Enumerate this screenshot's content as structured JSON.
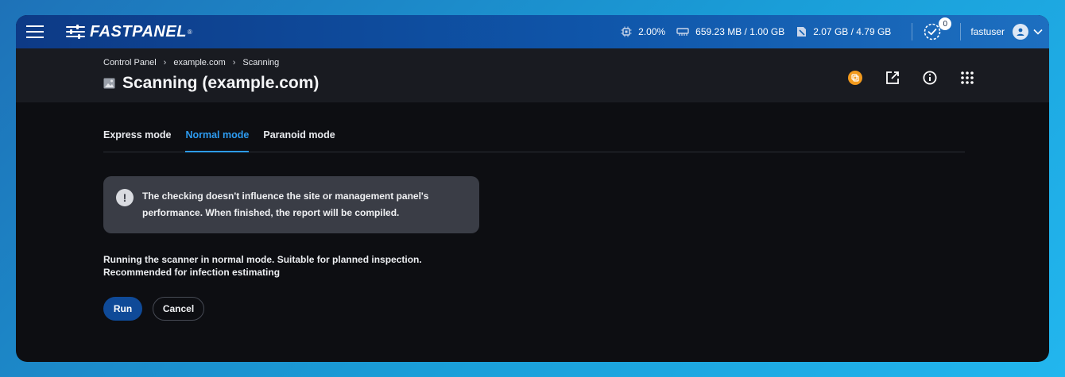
{
  "topbar": {
    "logo_text": "FASTPANEL",
    "logo_reg": "®",
    "cpu": "2.00%",
    "ram": "659.23 MB / 1.00 GB",
    "disk": "2.07 GB / 4.79 GB",
    "tasks_count": "0",
    "username": "fastuser"
  },
  "breadcrumb": {
    "items": [
      "Control Panel",
      "example.com",
      "Scanning"
    ],
    "separator": "›"
  },
  "page": {
    "title": "Scanning (example.com)"
  },
  "tabs": [
    {
      "label": "Express mode",
      "active": false
    },
    {
      "label": "Normal mode",
      "active": true
    },
    {
      "label": "Paranoid mode",
      "active": false
    }
  ],
  "notice": {
    "icon": "!",
    "line1": "The checking doesn't influence the site or management panel's",
    "line2": "performance. When finished, the report will be compiled."
  },
  "description": {
    "line1": "Running the scanner in normal mode. Suitable for planned inspection.",
    "line2": "Recommended for infection estimating"
  },
  "actions": {
    "run_label": "Run",
    "cancel_label": "Cancel"
  },
  "colors": {
    "accent": "#2d9bf0",
    "run_button": "#0f4a98",
    "coin": "#f29a1d"
  }
}
